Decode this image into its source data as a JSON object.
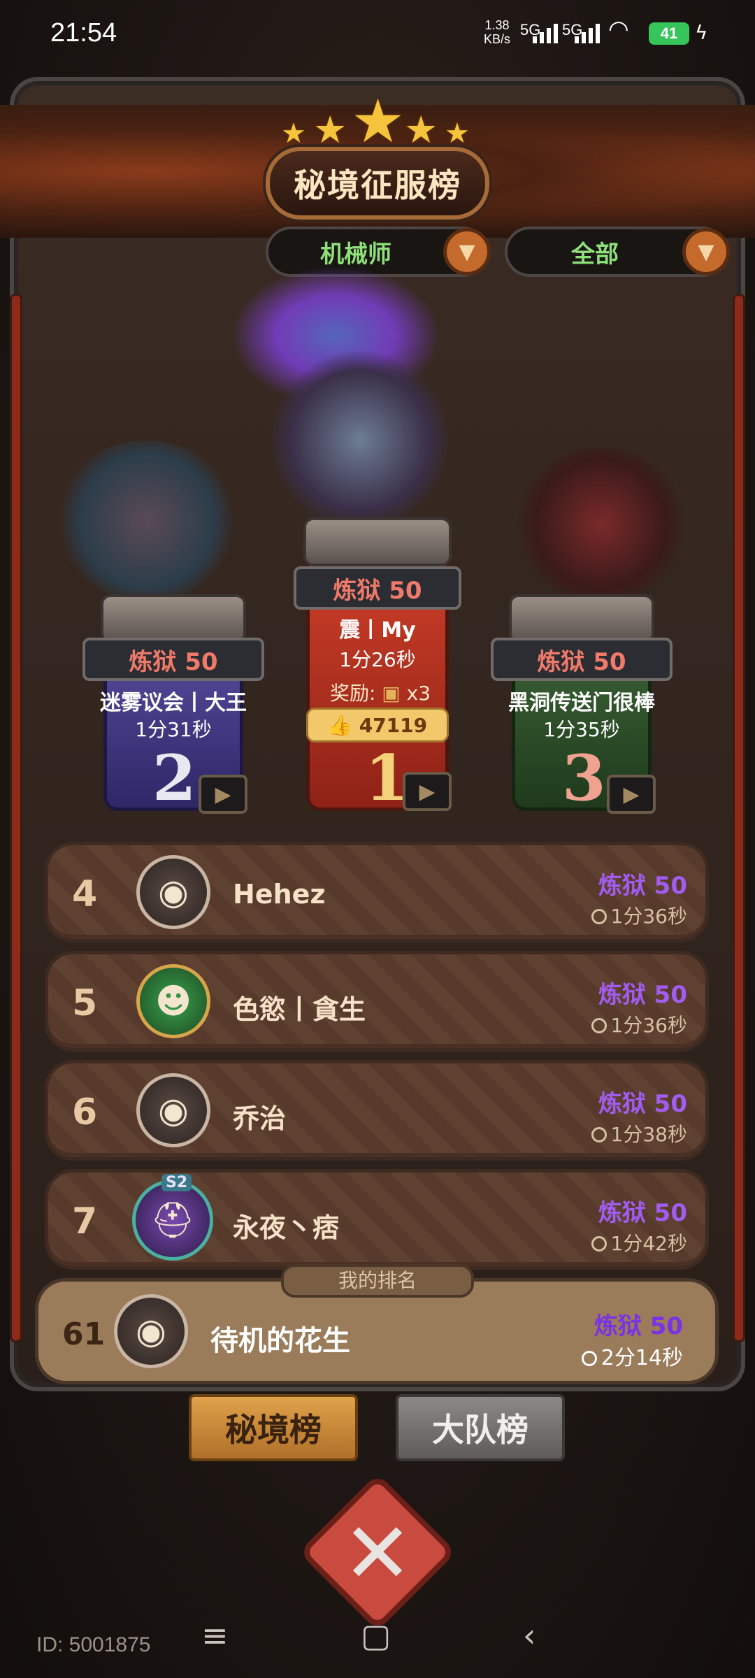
{
  "status_bar": {
    "time": "21:54",
    "net_speed_top": "1.38",
    "net_speed_unit": "KB/s",
    "signal1_label": "5G",
    "signal2_label": "5G",
    "battery": "41"
  },
  "header": {
    "title": "秘境征服榜",
    "filter_class": "机械师",
    "filter_scope": "全部"
  },
  "podium": [
    {
      "rank": "1",
      "level": "炼狱 50",
      "name": "震丨My",
      "time": "1分26秒",
      "reward_label": "奖励:",
      "reward_qty": "x3",
      "likes": "47119"
    },
    {
      "rank": "2",
      "level": "炼狱 50",
      "name": "迷雾议会丨大王",
      "time": "1分31秒"
    },
    {
      "rank": "3",
      "level": "炼狱 50",
      "name": "黑洞传送门很棒",
      "time": "1分35秒"
    }
  ],
  "list": [
    {
      "rank": "4",
      "name": "Hehez",
      "level": "炼狱 50",
      "time": "1分36秒",
      "avatar_icon": "goggles-avatar-icon"
    },
    {
      "rank": "5",
      "name": "色慾丨貪生",
      "level": "炼狱 50",
      "time": "1分36秒",
      "avatar_icon": "green-grin-avatar-icon"
    },
    {
      "rank": "6",
      "name": "乔治",
      "level": "炼狱 50",
      "time": "1分38秒",
      "avatar_icon": "goggles-avatar-icon"
    },
    {
      "rank": "7",
      "name": "永夜丶痞",
      "level": "炼狱 50",
      "time": "1分42秒",
      "avatar_icon": "s2-helmet-avatar-icon",
      "avatar_badge": "S2"
    }
  ],
  "my_rank": {
    "tag": "我的排名",
    "rank": "61",
    "name": "待机的花生",
    "level": "炼狱 50",
    "time": "2分14秒"
  },
  "tabs": {
    "active": "秘境榜",
    "inactive": "大队榜"
  },
  "footer": {
    "user_id": "ID: 5001875"
  },
  "colors": {
    "level_purple": "#a35cf2",
    "level_red": "#f07a6a",
    "filter_green": "#8fe07a",
    "tab_active": "#c98a3c",
    "tab_inactive": "#6f6c6a"
  }
}
